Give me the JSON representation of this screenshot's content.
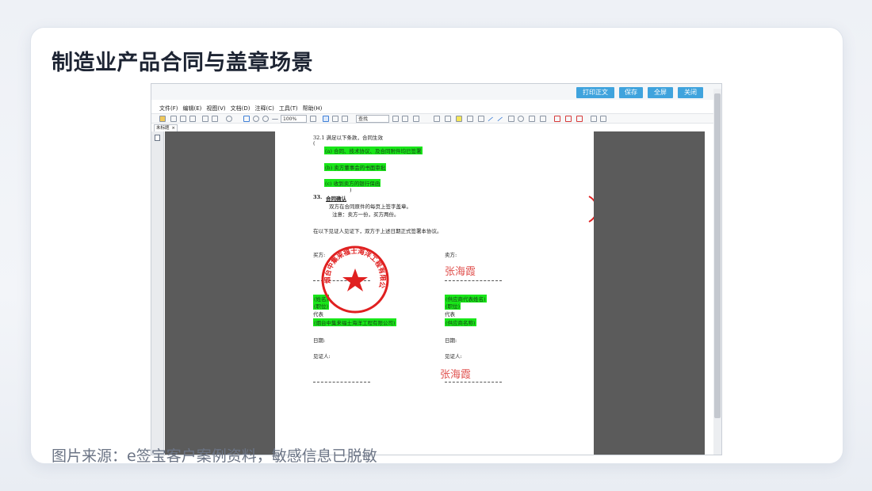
{
  "slide": {
    "title": "制造业产品合同与盖章场景",
    "caption": "图片来源：e签宝客户案例资料，敏感信息已脱敏"
  },
  "app": {
    "top_buttons": [
      "打印正文",
      "保存",
      "全屏",
      "关闭"
    ],
    "menu": [
      "文件(F)",
      "编辑(E)",
      "视图(V)",
      "文档(D)",
      "注释(C)",
      "工具(T)",
      "帮助(H)"
    ],
    "zoom": "100%",
    "search_placeholder": "查找",
    "tab_label": "未标题"
  },
  "document": {
    "clause_32": "32.1  满足以下条款，合同生效",
    "paren_open": "(",
    "item_a": "(a)  合同、技术协议、及合同附件均已签署",
    "item_b": "(b)  卖方董事会的书面审批",
    "item_c": "(c)  收到卖方的银行保函",
    "paren_close": ")",
    "clause_33_num": "33.",
    "clause_33_title": "合同确认",
    "line_1": "双方在合同原件的每页上签字盖章。",
    "line_2": "注意：卖方一份，买方两份。",
    "witness_line": "在以下见证人见证下，双方于上述日期正式签署本协议。",
    "buyer_label": "买方:",
    "seller_label": "卖方:",
    "buyer_name_field": "(姓名)",
    "buyer_title_field": "(职位)",
    "buyer_rep": "代表",
    "buyer_company": "(烟台中集来福士海洋工程有限公司)",
    "seller_name_field": "(供应商代表姓名)",
    "seller_title_field": "(职位)",
    "seller_rep": "代表",
    "seller_company": "(供应商名称)",
    "date_label_left": "日期:",
    "date_label_right": "日期:",
    "witness_label_left": "见证人:",
    "witness_label_right": "见证人:",
    "signature_1": "张海霞",
    "signature_2": "张海霞",
    "seal_text": "烟台中集来福士海洋工程有限公司"
  },
  "colors": {
    "highlight": "#19e619",
    "seal": "#e02020",
    "button": "#3fa3dd"
  }
}
